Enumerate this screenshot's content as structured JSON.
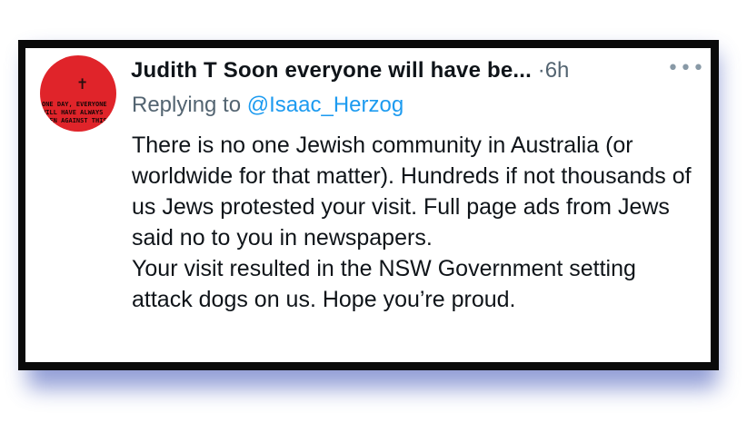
{
  "tweet": {
    "avatar": {
      "caption_lines": [
        "ONE DAY, EVERYONE",
        "WILL HAVE ALWAYS",
        "BEEN AGAINST THIS"
      ],
      "color": "#e0242a"
    },
    "author_display": "Judith T Soon everyone will have be...",
    "separator": "·",
    "time": "6h",
    "more_label": "•••",
    "replying_prefix": "Replying to",
    "replying_handle": "@Isaac_Herzog",
    "body_paragraphs": [
      "There is no one Jewish community in Australia (or worldwide for that matter). Hundreds if not thousands of us Jews protested your visit. Full page ads from Jews said no to you in newspapers.",
      "Your visit resulted in the NSW Government setting attack dogs on us. Hope you’re proud."
    ],
    "colors": {
      "frame": "#0a0a0a",
      "shadow": "#6f7fc9",
      "link": "#1d9bf0",
      "secondary_text": "#536471"
    }
  }
}
